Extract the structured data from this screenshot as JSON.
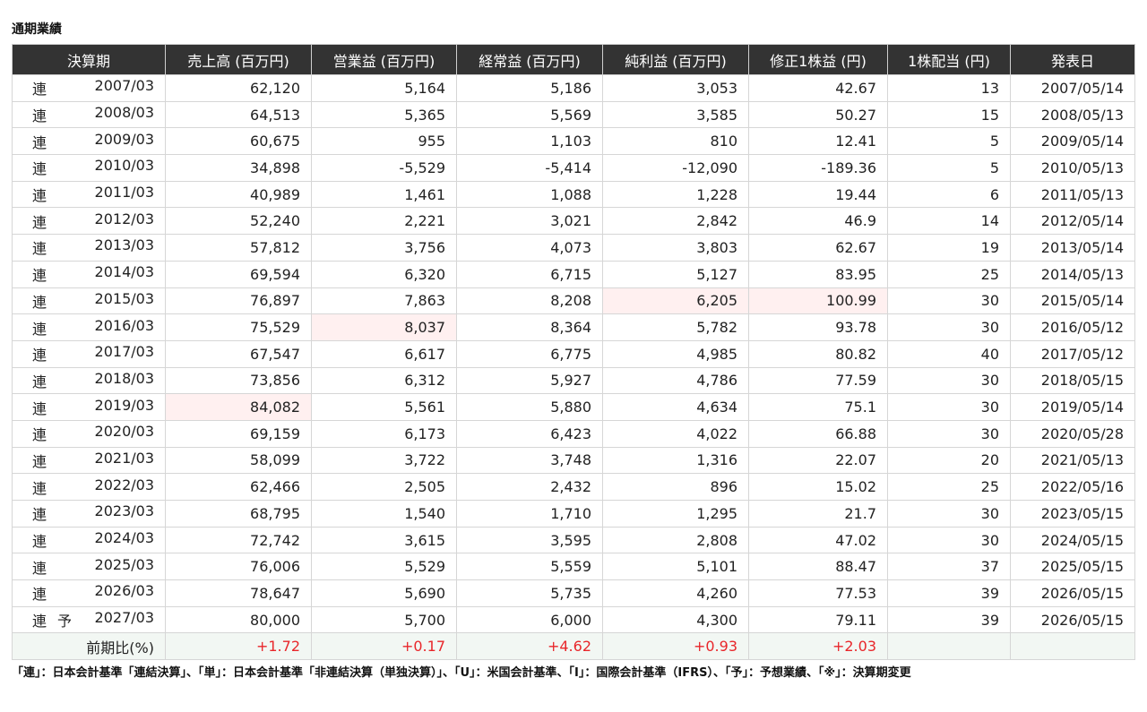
{
  "title": "通期業績",
  "columns": [
    "決算期",
    "売上高 (百万円)",
    "営業益 (百万円)",
    "経常益 (百万円)",
    "純利益 (百万円)",
    "修正1株益 (円)",
    "1株配当 (円)",
    "発表日"
  ],
  "rows": [
    {
      "type": "連",
      "forecast": "",
      "period": "2007/03",
      "sales": "62,120",
      "op": "5,164",
      "ord": "5,186",
      "net": "3,053",
      "eps": "42.67",
      "div": "13",
      "date": "2007/05/14"
    },
    {
      "type": "連",
      "forecast": "",
      "period": "2008/03",
      "sales": "64,513",
      "op": "5,365",
      "ord": "5,569",
      "net": "3,585",
      "eps": "50.27",
      "div": "15",
      "date": "2008/05/13"
    },
    {
      "type": "連",
      "forecast": "",
      "period": "2009/03",
      "sales": "60,675",
      "op": "955",
      "ord": "1,103",
      "net": "810",
      "eps": "12.41",
      "div": "5",
      "date": "2009/05/14"
    },
    {
      "type": "連",
      "forecast": "",
      "period": "2010/03",
      "sales": "34,898",
      "op": "-5,529",
      "ord": "-5,414",
      "net": "-12,090",
      "eps": "-189.36",
      "div": "5",
      "date": "2010/05/13"
    },
    {
      "type": "連",
      "forecast": "",
      "period": "2011/03",
      "sales": "40,989",
      "op": "1,461",
      "ord": "1,088",
      "net": "1,228",
      "eps": "19.44",
      "div": "6",
      "date": "2011/05/13"
    },
    {
      "type": "連",
      "forecast": "",
      "period": "2012/03",
      "sales": "52,240",
      "op": "2,221",
      "ord": "3,021",
      "net": "2,842",
      "eps": "46.9",
      "div": "14",
      "date": "2012/05/14"
    },
    {
      "type": "連",
      "forecast": "",
      "period": "2013/03",
      "sales": "57,812",
      "op": "3,756",
      "ord": "4,073",
      "net": "3,803",
      "eps": "62.67",
      "div": "19",
      "date": "2013/05/14"
    },
    {
      "type": "連",
      "forecast": "",
      "period": "2014/03",
      "sales": "69,594",
      "op": "6,320",
      "ord": "6,715",
      "net": "5,127",
      "eps": "83.95",
      "div": "25",
      "date": "2014/05/13"
    },
    {
      "type": "連",
      "forecast": "",
      "period": "2015/03",
      "sales": "76,897",
      "op": "7,863",
      "ord": "8,208",
      "net": "6,205",
      "eps": "100.99",
      "div": "30",
      "date": "2015/05/14"
    },
    {
      "type": "連",
      "forecast": "",
      "period": "2016/03",
      "sales": "75,529",
      "op": "8,037",
      "ord": "8,364",
      "net": "5,782",
      "eps": "93.78",
      "div": "30",
      "date": "2016/05/12"
    },
    {
      "type": "連",
      "forecast": "",
      "period": "2017/03",
      "sales": "67,547",
      "op": "6,617",
      "ord": "6,775",
      "net": "4,985",
      "eps": "80.82",
      "div": "40",
      "date": "2017/05/12"
    },
    {
      "type": "連",
      "forecast": "",
      "period": "2018/03",
      "sales": "73,856",
      "op": "6,312",
      "ord": "5,927",
      "net": "4,786",
      "eps": "77.59",
      "div": "30",
      "date": "2018/05/15"
    },
    {
      "type": "連",
      "forecast": "",
      "period": "2019/03",
      "sales": "84,082",
      "op": "5,561",
      "ord": "5,880",
      "net": "4,634",
      "eps": "75.1",
      "div": "30",
      "date": "2019/05/14"
    },
    {
      "type": "連",
      "forecast": "",
      "period": "2020/03",
      "sales": "69,159",
      "op": "6,173",
      "ord": "6,423",
      "net": "4,022",
      "eps": "66.88",
      "div": "30",
      "date": "2020/05/28"
    },
    {
      "type": "連",
      "forecast": "",
      "period": "2021/03",
      "sales": "58,099",
      "op": "3,722",
      "ord": "3,748",
      "net": "1,316",
      "eps": "22.07",
      "div": "20",
      "date": "2021/05/13"
    },
    {
      "type": "連",
      "forecast": "",
      "period": "2022/03",
      "sales": "62,466",
      "op": "2,505",
      "ord": "2,432",
      "net": "896",
      "eps": "15.02",
      "div": "25",
      "date": "2022/05/16"
    },
    {
      "type": "連",
      "forecast": "",
      "period": "2023/03",
      "sales": "68,795",
      "op": "1,540",
      "ord": "1,710",
      "net": "1,295",
      "eps": "21.7",
      "div": "30",
      "date": "2023/05/15"
    },
    {
      "type": "連",
      "forecast": "",
      "period": "2024/03",
      "sales": "72,742",
      "op": "3,615",
      "ord": "3,595",
      "net": "2,808",
      "eps": "47.02",
      "div": "30",
      "date": "2024/05/15"
    },
    {
      "type": "連",
      "forecast": "",
      "period": "2025/03",
      "sales": "76,006",
      "op": "5,529",
      "ord": "5,559",
      "net": "5,101",
      "eps": "88.47",
      "div": "37",
      "date": "2025/05/15"
    },
    {
      "type": "連",
      "forecast": "",
      "period": "2026/03",
      "sales": "78,647",
      "op": "5,690",
      "ord": "5,735",
      "net": "4,260",
      "eps": "77.53",
      "div": "39",
      "date": "2026/05/15"
    },
    {
      "type": "連",
      "forecast": "予",
      "period": "2027/03",
      "sales": "80,000",
      "op": "5,700",
      "ord": "6,000",
      "net": "4,300",
      "eps": "79.11",
      "div": "39",
      "date": "2026/05/15"
    }
  ],
  "yoy": {
    "label": "前期比(%)",
    "sales": "+1.72",
    "op": "+0.17",
    "ord": "+4.62",
    "net": "+0.93",
    "eps": "+2.03",
    "div": "",
    "date": ""
  },
  "highlights": [
    {
      "row": 12,
      "col": "sales"
    },
    {
      "row": 9,
      "col": "op"
    },
    {
      "row": 8,
      "col": "net"
    },
    {
      "row": 8,
      "col": "eps"
    }
  ],
  "colors": {
    "header_bg": "#333333",
    "highlight_bg": "#fff0f0",
    "yoy_bg": "#f2f7f3",
    "positive_text": "#e8262a"
  },
  "footnote": "「連」：日本会計基準「連結決算」、「単」：日本会計基準「非連結決算（単独決算）」、「U」：米国会計基準、「I」：国際会計基準（IFRS）、「予」：予想業績、「※」：決算期変更"
}
